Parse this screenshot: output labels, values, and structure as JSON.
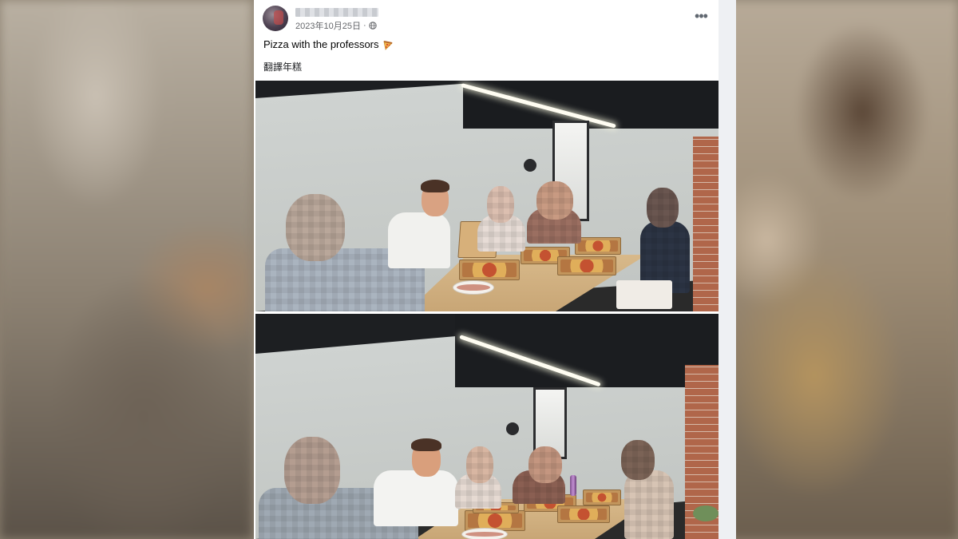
{
  "post": {
    "author_hidden": true,
    "date": "2023年10月25日",
    "separator": "·",
    "more_label": "•••",
    "text": "Pizza with the professors",
    "translate_label": "翻譯年糕"
  },
  "icons": {
    "audience": "globe-icon",
    "emoji": "pizza-icon",
    "more": "more-options-icon"
  },
  "photos": [
    {
      "name": "group-photo-1",
      "alt": "People sitting around a table with pizza boxes, faces pixelated"
    },
    {
      "name": "group-photo-2",
      "alt": "Second view of the group around the table with pizza boxes, faces pixelated"
    }
  ],
  "colors": {
    "card_bg": "#ffffff",
    "meta_text": "#65676b",
    "body_text": "#050505"
  }
}
